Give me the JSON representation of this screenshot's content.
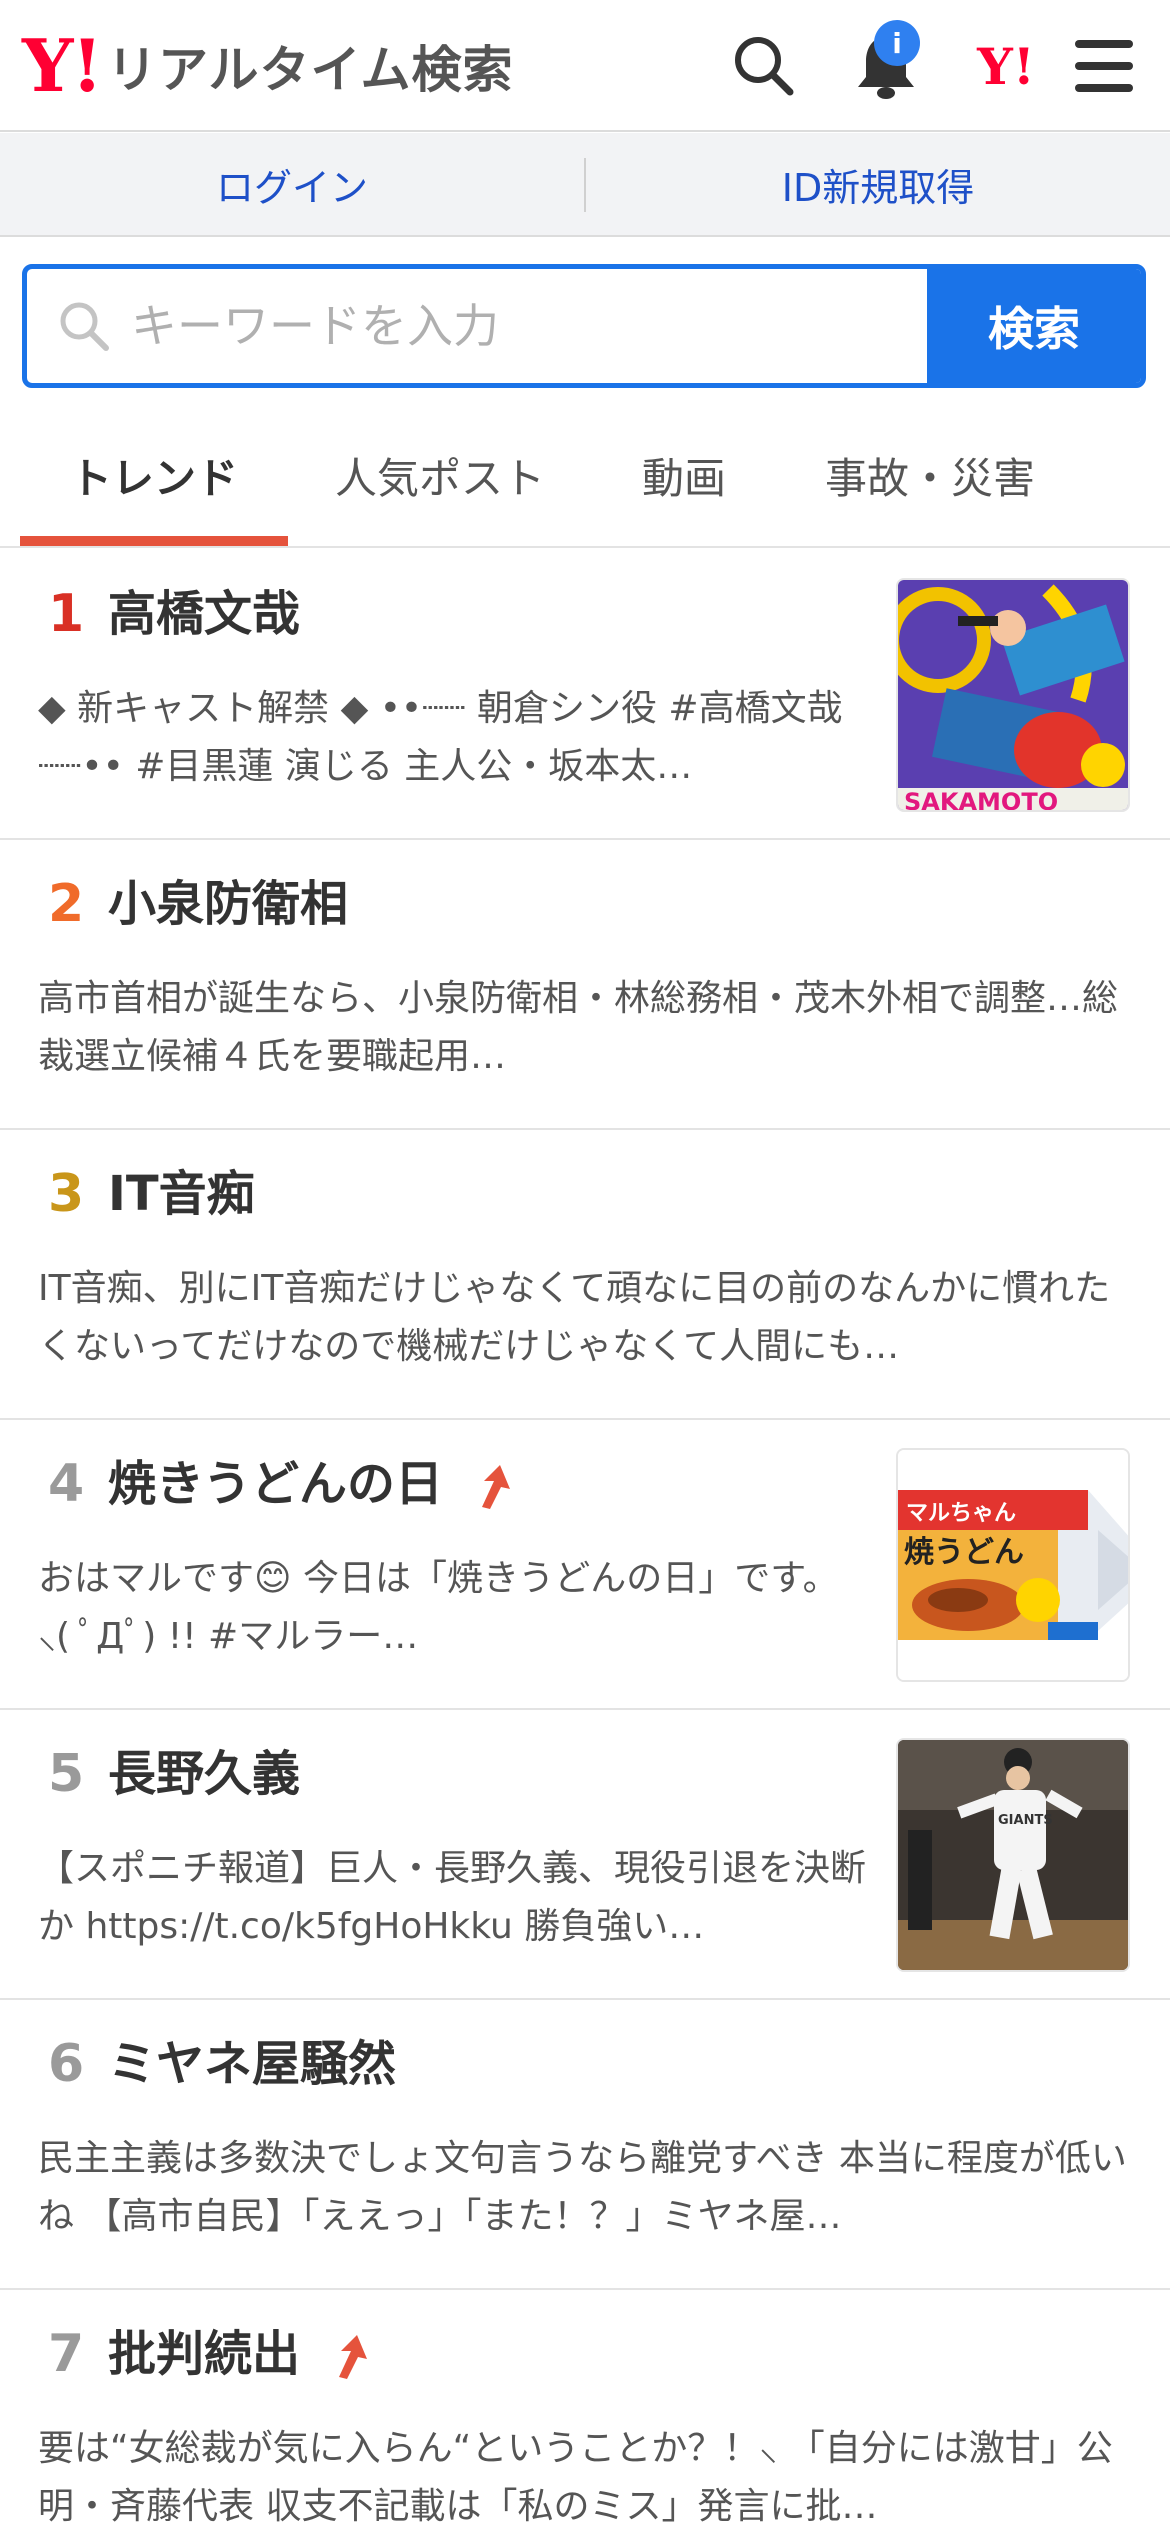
{
  "header": {
    "logo_mark": "Y!",
    "logo_text": "リアルタイム検索",
    "notification_badge": "i",
    "yahoo_mark": "Y!"
  },
  "auth": {
    "login": "ログイン",
    "signup": "ID新規取得"
  },
  "search": {
    "placeholder": "キーワードを入力",
    "button": "検索"
  },
  "tabs": [
    {
      "label": "トレンド",
      "active": true
    },
    {
      "label": "人気ポスト",
      "active": false
    },
    {
      "label": "動画",
      "active": false
    },
    {
      "label": "事故・災害",
      "active": false
    }
  ],
  "trends": [
    {
      "rank": "1",
      "rank_color": "#d93025",
      "title": "高橋文哉",
      "rising": false,
      "thumbnail": "anime-poster",
      "desc": "◆ 新キャスト解禁 ◆ ••┈┈ 朝倉シン役 #高橋文哉 ┈┈•• #目黒蓮 演じる 主人公・坂本太…",
      "thumb_caption": "SAKAMOTO"
    },
    {
      "rank": "2",
      "rank_color": "#f06b2a",
      "title": "小泉防衛相",
      "rising": false,
      "thumbnail": "",
      "desc": "高市首相が誕生なら、小泉防衛相・林総務相・茂木外相で調整…総裁選立候補４氏を要職起用…"
    },
    {
      "rank": "3",
      "rank_color": "#c9961a",
      "title": "IT音痴",
      "rising": false,
      "thumbnail": "",
      "desc": "IT音痴、別にIT音痴だけじゃなくて頑なに目の前のなんかに慣れたくないってだけなので機械だけじゃなくて人間にも…"
    },
    {
      "rank": "4",
      "rank_color": "#9a9a9a",
      "title": "焼きうどんの日",
      "rising": true,
      "thumbnail": "noodle-package",
      "desc": "おはマルです😊 今日は「焼きうどんの日」です。 ⸜( ﾟДﾟ) !! #マルラー…",
      "thumb_caption": "焼うどん"
    },
    {
      "rank": "5",
      "rank_color": "#9a9a9a",
      "title": "長野久義",
      "rising": false,
      "thumbnail": "baseball-player",
      "desc": "【スポニチ報道】巨人・長野久義、現役引退を決断か https://t.co/k5fgHoHkku 勝負強い…",
      "thumb_caption": "GIANTS"
    },
    {
      "rank": "6",
      "rank_color": "#9a9a9a",
      "title": "ミヤネ屋騒然",
      "rising": false,
      "thumbnail": "",
      "desc": "民主主義は多数決でしょ文句言うなら離党すべき 本当に程度が低いね 【高市自民】「ええっ」「また！？」ミヤネ屋…"
    },
    {
      "rank": "7",
      "rank_color": "#9a9a9a",
      "title": "批判続出",
      "rising": true,
      "thumbnail": "",
      "desc": "要は“女総裁が気に入らん“ということか？！⸜ 「自分には激甘」公明・斉藤代表 収支不記載は「私のミス」発言に批…"
    }
  ]
}
